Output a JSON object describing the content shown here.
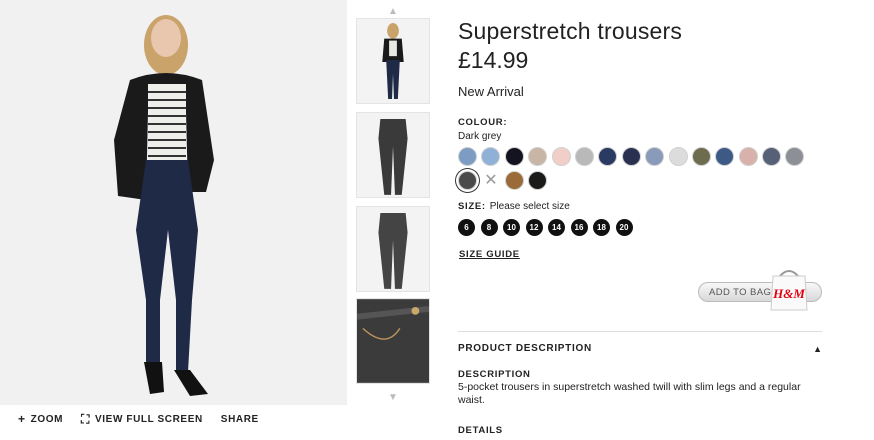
{
  "product": {
    "title": "Superstretch trousers",
    "price": "£14.99",
    "badge": "New Arrival"
  },
  "colour": {
    "label": "COLOUR:",
    "selected": "Dark grey",
    "swatches": [
      {
        "name": "light denim blue",
        "color": "#7d9cc4"
      },
      {
        "name": "pale denim blue",
        "color": "#8fb1d8"
      },
      {
        "name": "black",
        "color": "#141420"
      },
      {
        "name": "beige pattern",
        "color": "#c8b5a6"
      },
      {
        "name": "light pink",
        "color": "#f1cfc8"
      },
      {
        "name": "light grey",
        "color": "#b9b9b9"
      },
      {
        "name": "dark denim blue",
        "color": "#2b3a63"
      },
      {
        "name": "navy",
        "color": "#2a3150"
      },
      {
        "name": "blue check",
        "color": "#8a9abb"
      },
      {
        "name": "light stripe",
        "color": "#dcdcdc"
      },
      {
        "name": "khaki green",
        "color": "#6d6c4e"
      },
      {
        "name": "denim pattern",
        "color": "#3d5a86"
      },
      {
        "name": "dusty pink",
        "color": "#d9b1ab"
      },
      {
        "name": "dark check",
        "color": "#566077"
      },
      {
        "name": "grey check",
        "color": "#8c8f96"
      },
      {
        "name": "dark grey",
        "color": "#4a4a4a"
      },
      {
        "name": "unavailable",
        "color": "#ffffff"
      },
      {
        "name": "camel",
        "color": "#9a6b38"
      },
      {
        "name": "black suede",
        "color": "#1c1a18"
      }
    ]
  },
  "size": {
    "label": "SIZE:",
    "hint": "Please select size",
    "options": [
      "6",
      "8",
      "10",
      "12",
      "14",
      "16",
      "18",
      "20"
    ],
    "guide": "SIZE GUIDE"
  },
  "cart": {
    "add_to_bag": "ADD TO BAG",
    "brand": "H&M"
  },
  "description": {
    "section": "PRODUCT DESCRIPTION",
    "heading": "DESCRIPTION",
    "text": "5-pocket trousers in superstretch washed twill with slim legs and a regular waist.",
    "details": "DETAILS"
  },
  "image_tools": {
    "zoom": "ZOOM",
    "full_screen": "VIEW FULL SCREEN",
    "share": "SHARE"
  },
  "colors": {
    "size_chip": "#111111",
    "brand_red": "#e50010"
  },
  "icons": {
    "thumb_up": "chevron-up-icon",
    "thumb_down": "chevron-down-icon",
    "zoom": "plus-icon",
    "fullscreen": "expand-icon",
    "collapse": "triangle-up-icon"
  }
}
